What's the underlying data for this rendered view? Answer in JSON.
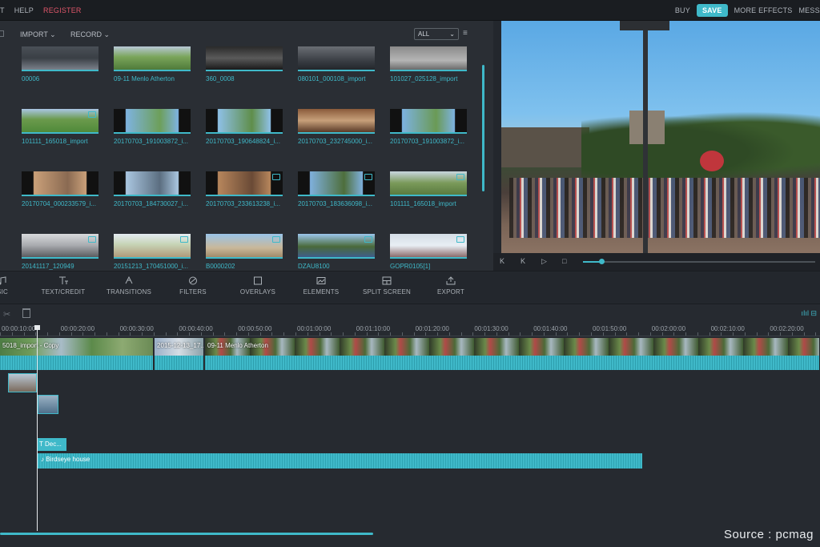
{
  "topbar": {
    "left": [
      "T",
      "HELP",
      "REGISTER"
    ],
    "right": [
      "BUY",
      "SAVE",
      "MORE EFFECTS",
      "MESSA"
    ]
  },
  "media": {
    "import_label": "IMPORT ⌄",
    "record_label": "RECORD ⌄",
    "filter_value": "ALL",
    "filter_arrow": "⌄",
    "list_icon": "≡",
    "items": [
      {
        "label": "00006",
        "video": false
      },
      {
        "label": "09-11 Menlo Atherton",
        "video": false
      },
      {
        "label": "360_0008",
        "video": false
      },
      {
        "label": "080101_000108_import",
        "video": false
      },
      {
        "label": "101027_025128_import",
        "video": false
      },
      {
        "label": "101111_165018_import",
        "video": true
      },
      {
        "label": "20170703_191003872_i...",
        "video": false
      },
      {
        "label": "20170703_190648824_i...",
        "video": false
      },
      {
        "label": "20170703_232745000_i...",
        "video": false
      },
      {
        "label": "20170703_191003872_i...",
        "video": false
      },
      {
        "label": "20170704_000233579_i...",
        "video": false
      },
      {
        "label": "20170703_184730027_i...",
        "video": false
      },
      {
        "label": "20170703_233613238_i...",
        "video": true
      },
      {
        "label": "20170703_183636098_i...",
        "video": true
      },
      {
        "label": "101111_165018_import",
        "video": true
      },
      {
        "label": "20141117_120949",
        "video": true
      },
      {
        "label": "20151213_170451000_i...",
        "video": true
      },
      {
        "label": "B0000202",
        "video": true
      },
      {
        "label": "DZAU8100",
        "video": true
      },
      {
        "label": "GOPR0105[1]",
        "video": true
      }
    ]
  },
  "player": {
    "buttons": [
      "K",
      "K",
      "▷",
      "□"
    ],
    "progress": 0.08
  },
  "tools": [
    "SIC",
    "TEXT/CREDIT",
    "TRANSITIONS",
    "FILTERS",
    "OVERLAYS",
    "ELEMENTS",
    "SPLIT SCREEN",
    "EXPORT"
  ],
  "timeline": {
    "ticks": [
      "00:00:10:00",
      "00:00:20:00",
      "00:00:30:00",
      "00:00:40:00",
      "00:00:50:00",
      "00:01:00:00",
      "00:01:10:00",
      "00:01:20:00",
      "00:01:30:00",
      "00:01:40:00",
      "00:01:50:00",
      "00:02:00:00",
      "00:02:10:00",
      "00:02:20:00"
    ],
    "clips": [
      "5018_import - Copy",
      "2015-12-13_17...",
      "09-11 Menlo Atherton"
    ],
    "title_clip": "Dec...",
    "audio_clip": "Birdseye house"
  },
  "source_caption": "Source : pcmag"
}
